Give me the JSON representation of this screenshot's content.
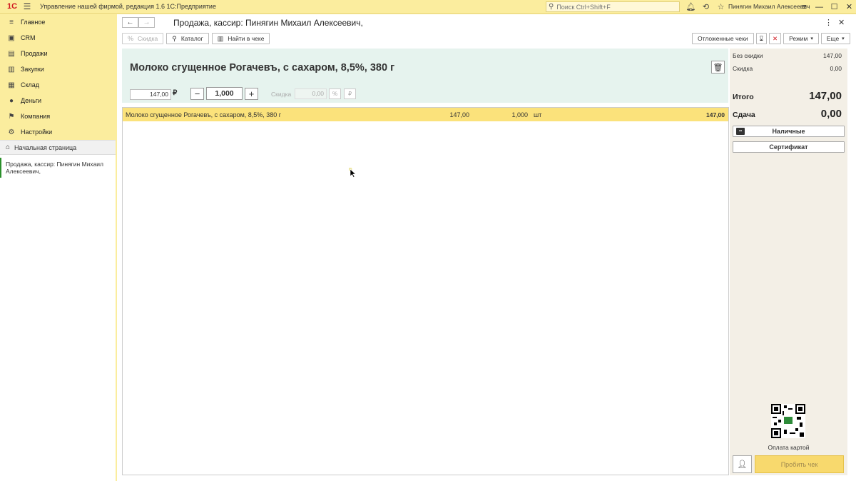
{
  "titlebar": {
    "logo": "1С",
    "app_title": "Управление нашей фирмой, редакция 1.6 1С:Предприятие",
    "search_placeholder": "Поиск Ctrl+Shift+F",
    "user": "Пинягин Михаил Алексеевич"
  },
  "sidebar": {
    "items": [
      {
        "label": "Главное",
        "icon": "menu-icon"
      },
      {
        "label": "CRM",
        "icon": "crm-icon"
      },
      {
        "label": "Продажи",
        "icon": "sales-icon"
      },
      {
        "label": "Закупки",
        "icon": "purchases-icon"
      },
      {
        "label": "Склад",
        "icon": "warehouse-icon"
      },
      {
        "label": "Деньги",
        "icon": "money-icon"
      },
      {
        "label": "Компания",
        "icon": "flag-icon"
      },
      {
        "label": "Настройки",
        "icon": "gear-icon"
      }
    ],
    "home": "Начальная страница",
    "open_window": "Продажа, кассир: Пинягин Михаил Алексеевич,"
  },
  "form": {
    "title": "Продажа, кассир: Пинягин Михаил Алексеевич,"
  },
  "toolbar": {
    "discount": "Скидка",
    "catalog": "Каталог",
    "find_in_receipt": "Найти в чеке",
    "deferred": "Отложенные чеки",
    "mode": "Режим",
    "more": "Еще"
  },
  "product": {
    "name": "Молоко сгущенное Рогачевъ, с сахаром, 8,5%, 380 г",
    "price": "147,00",
    "currency": "₽",
    "quantity": "1,000",
    "discount_label": "Скидка",
    "discount_value": "0,00",
    "pct_symbol": "%",
    "rub_symbol": "₽"
  },
  "table": {
    "rows": [
      {
        "name": "Молоко сгущенное Рогачевъ, с сахаром, 8,5%, 380 г",
        "price": "147,00",
        "qty": "1,000",
        "unit": "шт",
        "sum": "147,00"
      }
    ]
  },
  "summary": {
    "no_discount_label": "Без скидки",
    "no_discount_value": "147,00",
    "discount_label": "Скидка",
    "discount_value": "0,00",
    "total_label": "Итого",
    "total_value": "147,00",
    "change_label": "Сдача",
    "change_value": "0,00",
    "cash_btn": "Наличные",
    "certificate_btn": "Сертификат",
    "card_payment": "Оплата картой",
    "print_receipt": "Пробить чек"
  },
  "colors": {
    "accent_yellow": "#fbed9e",
    "selected_row": "#fbe27b",
    "product_panel": "#e6f3ee",
    "pay_button": "#f8d96d"
  }
}
